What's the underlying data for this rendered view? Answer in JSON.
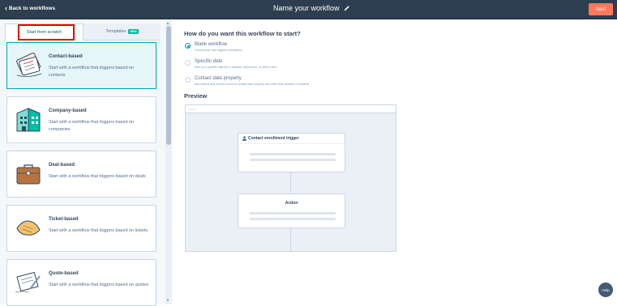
{
  "header": {
    "back_label": "Back to workflows",
    "workflow_name": "Name your workflow",
    "next_label": "Next"
  },
  "tabs": {
    "scratch_label": "Start from scratch",
    "templates_label": "Templates",
    "new_badge": "NEW"
  },
  "cards": [
    {
      "title": "Contact-based",
      "desc": "Start with a workflow that triggers based on contacts",
      "icon": "contact-card-icon"
    },
    {
      "title": "Company-based",
      "desc": "Start with a workflow that triggers based on companies",
      "icon": "building-icon"
    },
    {
      "title": "Deal-based",
      "desc": "Start with a workflow that triggers based on deals",
      "icon": "briefcase-icon"
    },
    {
      "title": "Ticket-based",
      "desc": "Start with a workflow that triggers based on tickets",
      "icon": "ticket-icon"
    },
    {
      "title": "Quote-based",
      "desc": "Start with a workflow that triggers based on quotes",
      "icon": "quote-pen-icon"
    }
  ],
  "main": {
    "question": "How do you want this workflow to start?",
    "options": [
      {
        "label": "Blank workflow",
        "desc": "Choose your own triggers and actions"
      },
      {
        "label": "Specific date",
        "desc": "Start on a specific date like a webinar, conference, or other event."
      },
      {
        "label": "Contact date property",
        "desc": "Add actions that revolve around a contact date property, like when they became a customer."
      }
    ],
    "preview_title": "Preview",
    "preview_dots": "○○○",
    "trigger_label": "Contact enrollment trigger",
    "action_label": "Action"
  },
  "help_label": "Help",
  "colors": {
    "topbar": "#2d3e50",
    "accent": "#ff7a59",
    "selected": "#00a4bd",
    "badge": "#00bda5"
  }
}
